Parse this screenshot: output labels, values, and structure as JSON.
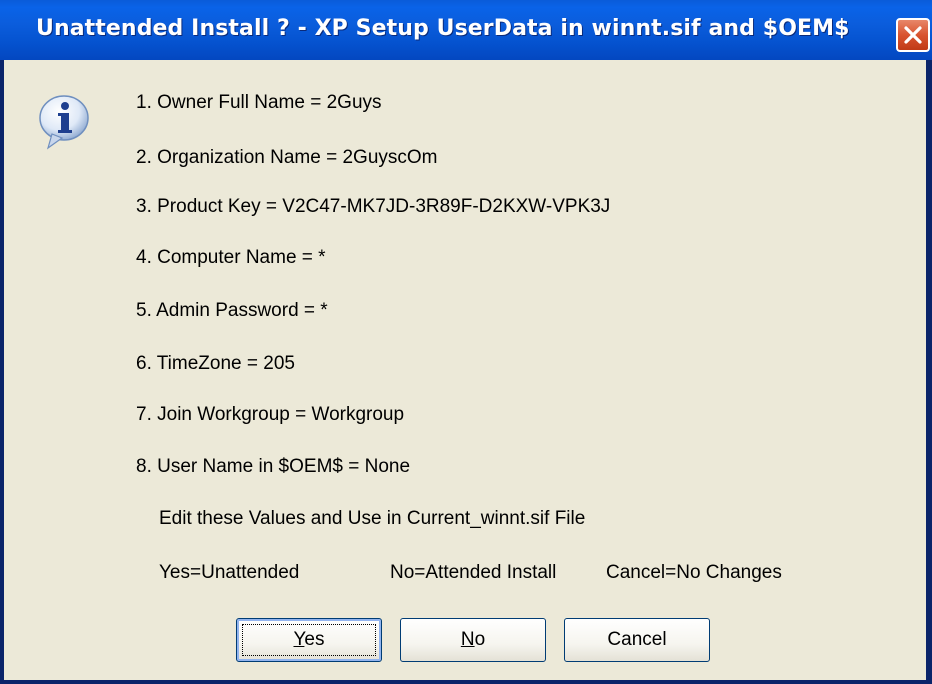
{
  "window": {
    "title": "Unattended Install ? - XP Setup UserData in winnt.sif and $OEM$"
  },
  "icons": {
    "info": "information-icon",
    "close": "close-icon"
  },
  "lines": [
    "1. Owner Full Name = 2Guys",
    "2. Organization Name = 2GuyscOm",
    "3. Product Key = V2C47-MK7JD-3R89F-D2KXW-VPK3J",
    "4. Computer Name = *",
    "5. Admin Password = *",
    "6. TimeZone = 205",
    "7. Join Workgroup = Workgroup",
    "8. User Name in $OEM$ = None"
  ],
  "edit_note": "Edit these Values and Use in Current_winnt.sif File",
  "legend": {
    "yes": "Yes=Unattended",
    "no": "No=Attended Install",
    "cancel": "Cancel=No Changes"
  },
  "buttons": {
    "yes": {
      "accel": "Y",
      "rest": "es"
    },
    "no": {
      "accel": "N",
      "rest": "o"
    },
    "cancel": "Cancel"
  },
  "colors": {
    "titlebar": "#0553d0",
    "client_bg": "#ece9d8",
    "close_btn": "#d9532f"
  }
}
